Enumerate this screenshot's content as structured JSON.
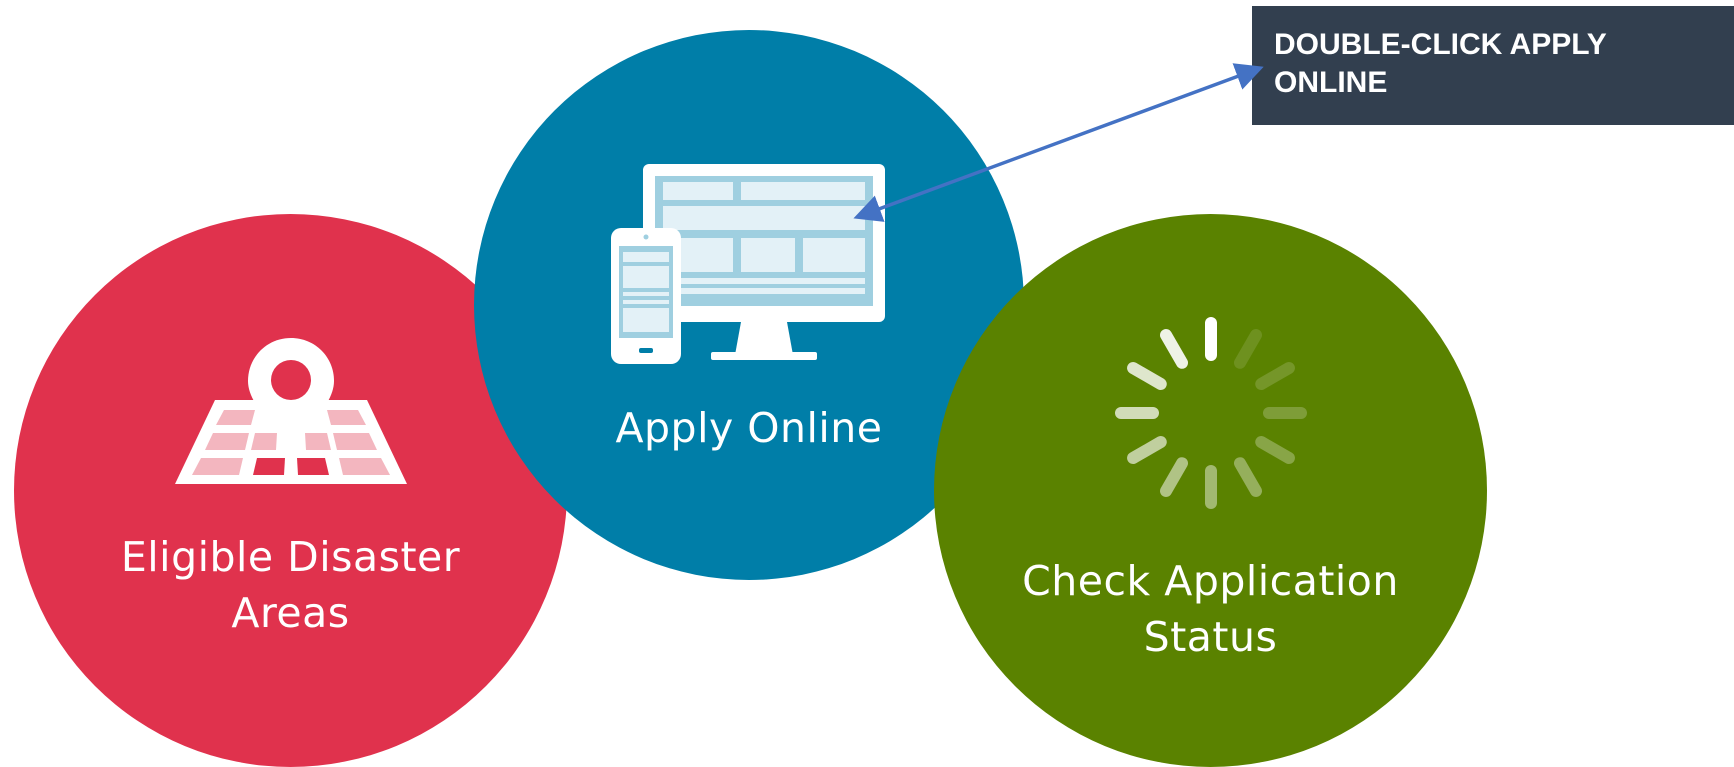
{
  "tiles": [
    {
      "label_line1": "Eligible Disaster",
      "label_line2": "Areas",
      "icon": "map-pin-icon",
      "color": "#e0324d"
    },
    {
      "label_line1": "Apply Online",
      "icon": "devices-icon",
      "color": "#007ea8"
    },
    {
      "label_line1": "Check Application",
      "label_line2": "Status",
      "icon": "loading-spinner-icon",
      "color": "#5a8200"
    }
  ],
  "callout": {
    "text": "DOUBLE-CLICK APPLY ONLINE",
    "background": "#323f4f",
    "arrow_color": "#4472c4"
  }
}
